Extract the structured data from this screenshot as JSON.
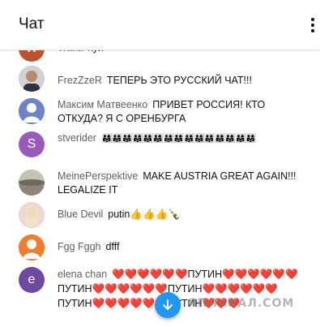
{
  "header": {
    "title": "Чат",
    "menu_icon": "kebab-menu-icon"
  },
  "messages": [
    {
      "author": "Wafla",
      "text": "хуй",
      "avatar": {
        "letter": "W",
        "color": "#c0532f"
      }
    },
    {
      "author": "FrezZzeR",
      "text": "ТЕПЕРЬ ЭТО РУССКИЙ ЧАТ!!!",
      "avatar": {
        "letter": "",
        "color": "#8a8f99"
      }
    },
    {
      "author": "Максим Матвеенко",
      "text": "ПРИВЕТ РОССИЯ! КТО ОТКУДА? Я С ОРЕНБУРГА",
      "avatar": {
        "letter": "",
        "color": "#6d84c8"
      }
    },
    {
      "author": "stverider",
      "text": "👨‍👩‍👧👨‍👩‍👧👨‍👩‍👧👨‍👩‍👧👨‍👩‍👧👨‍👩‍👧👨‍👩‍👧👨‍👩‍👧👨‍👩‍👧👨‍👩‍👧👨‍👩‍👧👨‍👩‍👧👨‍👩‍👧👨‍👩‍👧👨‍👩‍👧",
      "avatar": {
        "letter": "S",
        "color": "#9a5bb8"
      }
    },
    {
      "author": "MeinePerspektive",
      "text": "MAKE AUSTRIA GREAT AGAIN!!! LEGALIZE IT",
      "avatar": {
        "letter": "",
        "color": "#a8a39a"
      }
    },
    {
      "author": "Blue Devil",
      "text": "putin👍👍👍🍾",
      "avatar": {
        "letter": "",
        "color": "#e8bfb8"
      }
    },
    {
      "author": "Fgg Fggh",
      "text": "dfff",
      "avatar": {
        "letter": "",
        "color": "#f07d2e"
      }
    },
    {
      "author": "elena chan",
      "text": "❤️❤️❤️❤️❤️❤️ПУТИН❤️❤️❤️❤️❤️❤️ПУТИН❤️❤️❤️❤️❤️❤️ПУТИН❤️❤️❤️❤️❤️❤️ПУТИН❤️❤️❤️❤️❤️❤️ПУТИН❤️❤️❤️",
      "avatar": {
        "letter": "e",
        "color": "#6b4aa0"
      }
    }
  ],
  "scroll_button": {
    "icon": "arrow-down-icon",
    "color": "#2196f3"
  },
  "watermark": "ЯПЛАКАЛ.COM"
}
